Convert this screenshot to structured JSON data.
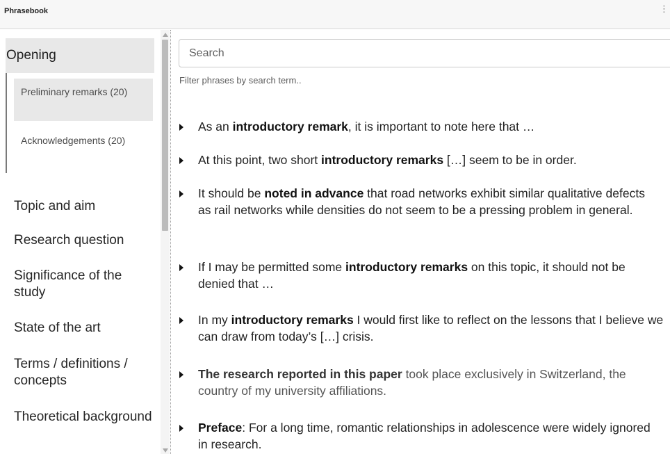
{
  "app": {
    "title": "Phrasebook",
    "more_icon": "more-vertical-icon"
  },
  "sidebar": {
    "active_section": "Opening",
    "subsections": [
      {
        "label": "Preliminary remarks (20)",
        "active": true
      },
      {
        "label": "Acknowledgements (20)",
        "active": false
      }
    ],
    "items": [
      "Topic and aim",
      "Research question",
      "Significance of the study",
      "State of the art",
      "Terms / definitions / concepts",
      "Theoretical background"
    ]
  },
  "search": {
    "placeholder": "Search",
    "value": "",
    "helper": "Filter phrases by search term.."
  },
  "phrases": [
    {
      "pre": "As an ",
      "bold": "introductory remark",
      "post": ", it is important to note here that …"
    },
    {
      "pre": "At this point, two short ",
      "bold": "introductory remarks",
      "post": " […] seem to be in order."
    },
    {
      "pre": "It should be ",
      "bold": "noted in advance",
      "post": " that road networks exhibit similar qualitative defects as rail networks while densities do not seem to be a pressing problem in general."
    },
    {
      "pre": "If I may be permitted some ",
      "bold": "introductory remarks",
      "post": " on this topic, it should not be denied that …"
    },
    {
      "pre": "In my ",
      "bold": "introductory remarks",
      "post": " I would first like to reflect on the lessons that I believe we can draw from today’s […] crisis."
    },
    {
      "pre": "",
      "bold": "The research reported in this paper",
      "post": " took place exclusively in Switzerland, the country of my university affiliations."
    },
    {
      "pre": "",
      "bold": "Preface",
      "post": ": For a long time, romantic relationships in adolescence were widely ignored in research."
    }
  ],
  "colors": {
    "section_bg": "#e8e8e8",
    "text": "#212121",
    "muted": "#5c5c5c"
  }
}
